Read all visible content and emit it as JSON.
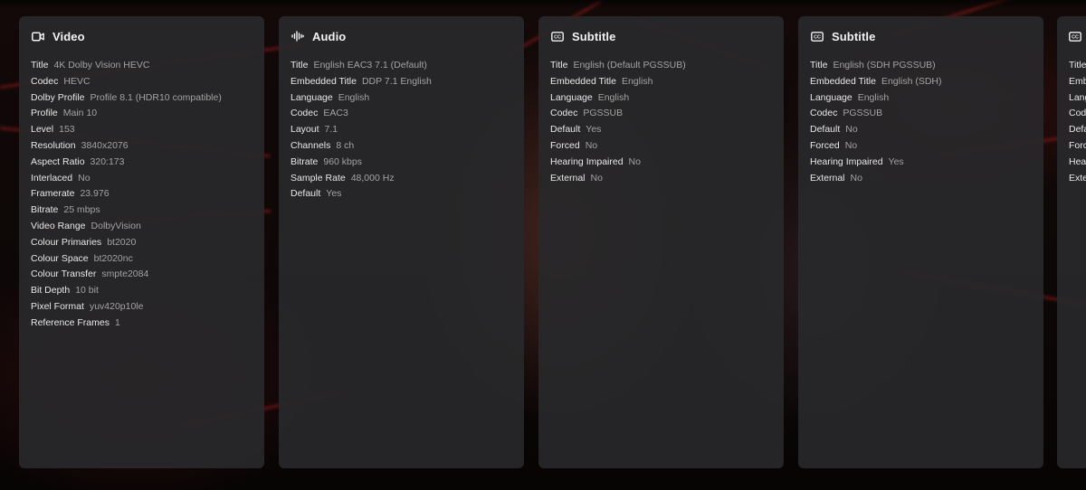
{
  "cards": [
    {
      "title": "Video",
      "icon": "video-camera-icon",
      "rows": [
        {
          "label": "Title",
          "value": "4K Dolby Vision HEVC"
        },
        {
          "label": "Codec",
          "value": "HEVC"
        },
        {
          "label": "Dolby Profile",
          "value": "Profile 8.1 (HDR10 compatible)"
        },
        {
          "label": "Profile",
          "value": "Main 10"
        },
        {
          "label": "Level",
          "value": "153"
        },
        {
          "label": "Resolution",
          "value": "3840x2076"
        },
        {
          "label": "Aspect Ratio",
          "value": "320:173"
        },
        {
          "label": "Interlaced",
          "value": "No"
        },
        {
          "label": "Framerate",
          "value": "23.976"
        },
        {
          "label": "Bitrate",
          "value": "25 mbps"
        },
        {
          "label": "Video Range",
          "value": "DolbyVision"
        },
        {
          "label": "Colour Primaries",
          "value": "bt2020"
        },
        {
          "label": "Colour Space",
          "value": "bt2020nc"
        },
        {
          "label": "Colour Transfer",
          "value": "smpte2084"
        },
        {
          "label": "Bit Depth",
          "value": "10 bit"
        },
        {
          "label": "Pixel Format",
          "value": "yuv420p10le"
        },
        {
          "label": "Reference Frames",
          "value": "1"
        }
      ]
    },
    {
      "title": "Audio",
      "icon": "audio-waveform-icon",
      "rows": [
        {
          "label": "Title",
          "value": "English EAC3 7.1 (Default)"
        },
        {
          "label": "Embedded Title",
          "value": "DDP 7.1 English"
        },
        {
          "label": "Language",
          "value": "English"
        },
        {
          "label": "Codec",
          "value": "EAC3"
        },
        {
          "label": "Layout",
          "value": "7.1"
        },
        {
          "label": "Channels",
          "value": "8 ch"
        },
        {
          "label": "Bitrate",
          "value": "960 kbps"
        },
        {
          "label": "Sample Rate",
          "value": "48,000 Hz"
        },
        {
          "label": "Default",
          "value": "Yes"
        }
      ]
    },
    {
      "title": "Subtitle",
      "icon": "closed-captions-icon",
      "rows": [
        {
          "label": "Title",
          "value": "English (Default PGSSUB)"
        },
        {
          "label": "Embedded Title",
          "value": "English"
        },
        {
          "label": "Language",
          "value": "English"
        },
        {
          "label": "Codec",
          "value": "PGSSUB"
        },
        {
          "label": "Default",
          "value": "Yes"
        },
        {
          "label": "Forced",
          "value": "No"
        },
        {
          "label": "Hearing Impaired",
          "value": "No"
        },
        {
          "label": "External",
          "value": "No"
        }
      ]
    },
    {
      "title": "Subtitle",
      "icon": "closed-captions-icon",
      "rows": [
        {
          "label": "Title",
          "value": "English (SDH PGSSUB)"
        },
        {
          "label": "Embedded Title",
          "value": "English (SDH)"
        },
        {
          "label": "Language",
          "value": "English"
        },
        {
          "label": "Codec",
          "value": "PGSSUB"
        },
        {
          "label": "Default",
          "value": "No"
        },
        {
          "label": "Forced",
          "value": "No"
        },
        {
          "label": "Hearing Impaired",
          "value": "Yes"
        },
        {
          "label": "External",
          "value": "No"
        }
      ]
    },
    {
      "title": "",
      "icon": "closed-captions-icon",
      "rows": [
        {
          "label": "Title",
          "value": ""
        },
        {
          "label": "Emb",
          "value": ""
        },
        {
          "label": "Lang",
          "value": ""
        },
        {
          "label": "Cod",
          "value": ""
        },
        {
          "label": "Defa",
          "value": ""
        },
        {
          "label": "Forc",
          "value": ""
        },
        {
          "label": "Hea",
          "value": ""
        },
        {
          "label": "Exte",
          "value": ""
        }
      ]
    }
  ]
}
